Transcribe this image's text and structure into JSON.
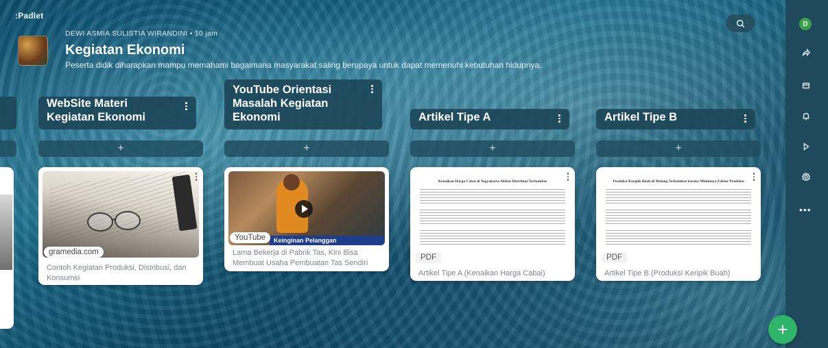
{
  "app": {
    "logo": ":Padlet"
  },
  "header": {
    "author": "DEWI ASMIA SULISTIA WIRANDINI",
    "separator": "•",
    "time": "10 jam",
    "title": "Kegiatan Ekonomi",
    "description": "Peserta didik diharapkan mampu memahami bagaimana masyarakat saling berupaya untuk dapat memenuhi kebutuhan hidupnya."
  },
  "sidebar": {
    "avatar_letter": "D",
    "items": [
      {
        "icon": "share-icon"
      },
      {
        "icon": "remake-icon"
      },
      {
        "icon": "bell-icon"
      },
      {
        "icon": "slideshow-icon"
      },
      {
        "icon": "settings-icon"
      },
      {
        "icon": "more-icon",
        "label": "•••"
      }
    ]
  },
  "columns": [
    {
      "title": "WebSite Materi Kegiatan Ekonomi",
      "add_label": "+",
      "card": {
        "source_chip": "gramedia.com",
        "caption": "Contoh Kegiatan Produksi, Distribusi, dan Konsumsi"
      }
    },
    {
      "title": "YouTube Orientasi Masalah Kegiatan Ekonomi",
      "add_label": "+",
      "card": {
        "source_chip": "YouTube",
        "video_banner": "Keinginan Pelanggan",
        "caption": "Lama Bekerja di Pabrik Tas, Kini Bisa Membuat Usaha Pembuatan Tas Sendiri"
      }
    },
    {
      "title": "Artikel Tipe A",
      "add_label": "+",
      "card": {
        "doc_title": "Kenaikan Harga Cabai di Yogyakarta Akibat Distribusi Terhambat",
        "source_chip": "PDF",
        "caption": "Artikel Tipe A (Kenaikan Harga Cabai)"
      }
    },
    {
      "title": "Artikel Tipe B",
      "add_label": "+",
      "card": {
        "doc_title": "Produksi Keripik Buah di Malang Terhambat karena Minimnya Faktor Produksi",
        "source_chip": "PDF",
        "caption": "Artikel Tipe B (Produksi Keripik Buah)"
      }
    }
  ],
  "fab": {
    "label": "+"
  },
  "colors": {
    "sidebar": "#1f4a5c",
    "fab": "#2fb56a",
    "avatar": "#3aa34a"
  }
}
